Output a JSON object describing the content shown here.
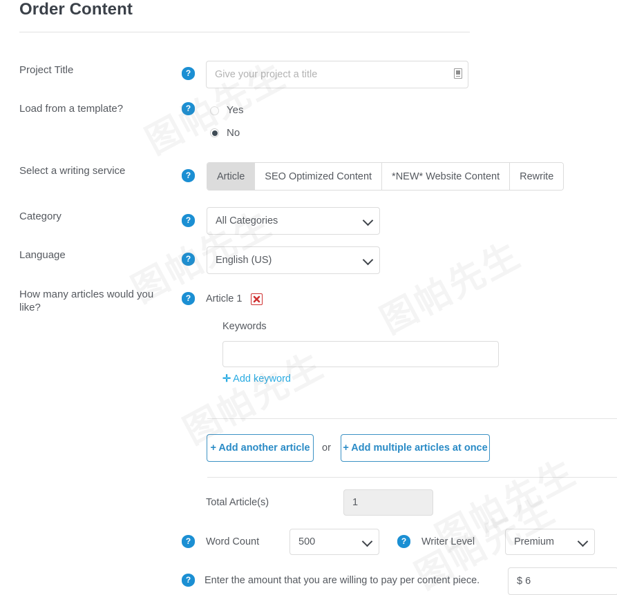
{
  "page": {
    "title": "Order Content"
  },
  "project_title": {
    "label": "Project Title",
    "help": "?",
    "placeholder": "Give your project a title",
    "value": "",
    "resize_icon": "resize-grip-icon"
  },
  "load_template": {
    "label": "Load from a template?",
    "help": "?",
    "options": [
      {
        "label": "Yes",
        "selected": false
      },
      {
        "label": "No",
        "selected": true
      }
    ]
  },
  "writing_service": {
    "label": "Select a writing service",
    "help": "?",
    "tabs": [
      {
        "label": "Article",
        "active": true
      },
      {
        "label": "SEO Optimized Content",
        "active": false
      },
      {
        "label": "*NEW* Website Content",
        "active": false
      },
      {
        "label": "Rewrite",
        "active": false
      }
    ]
  },
  "category": {
    "label": "Category",
    "help": "?",
    "value": "All Categories"
  },
  "language": {
    "label": "Language",
    "help": "?",
    "value": "English (US)"
  },
  "articles": {
    "label": "How many articles would you like?",
    "help": "?",
    "items": [
      {
        "title": "Article 1",
        "delete_icon": "delete-x-icon",
        "keywords_label": "Keywords",
        "keywords_value": "",
        "add_keyword_plus": "✛",
        "add_keyword_label": "Add keyword"
      }
    ],
    "add_article_label": "+ Add another article",
    "or_label": "or",
    "add_multiple_label": "+ Add multiple articles at once"
  },
  "total_articles": {
    "label": "Total Article(s)",
    "value": "1"
  },
  "word_count": {
    "help": "?",
    "label": "Word Count",
    "value": "500"
  },
  "writer_level": {
    "help": "?",
    "label": "Writer Level",
    "value": "Premium"
  },
  "price": {
    "help": "?",
    "label": "Enter the amount that you are willing to pay per content piece.",
    "value": "$ 6"
  },
  "watermark": {
    "text": "图帕先生"
  },
  "colors": {
    "help_blue": "#1b8fd3",
    "link_blue": "#29abe2",
    "button_blue": "#2a8bc6",
    "delete_red": "#cf3030",
    "heading": "#3b4149",
    "text": "#55595f"
  }
}
